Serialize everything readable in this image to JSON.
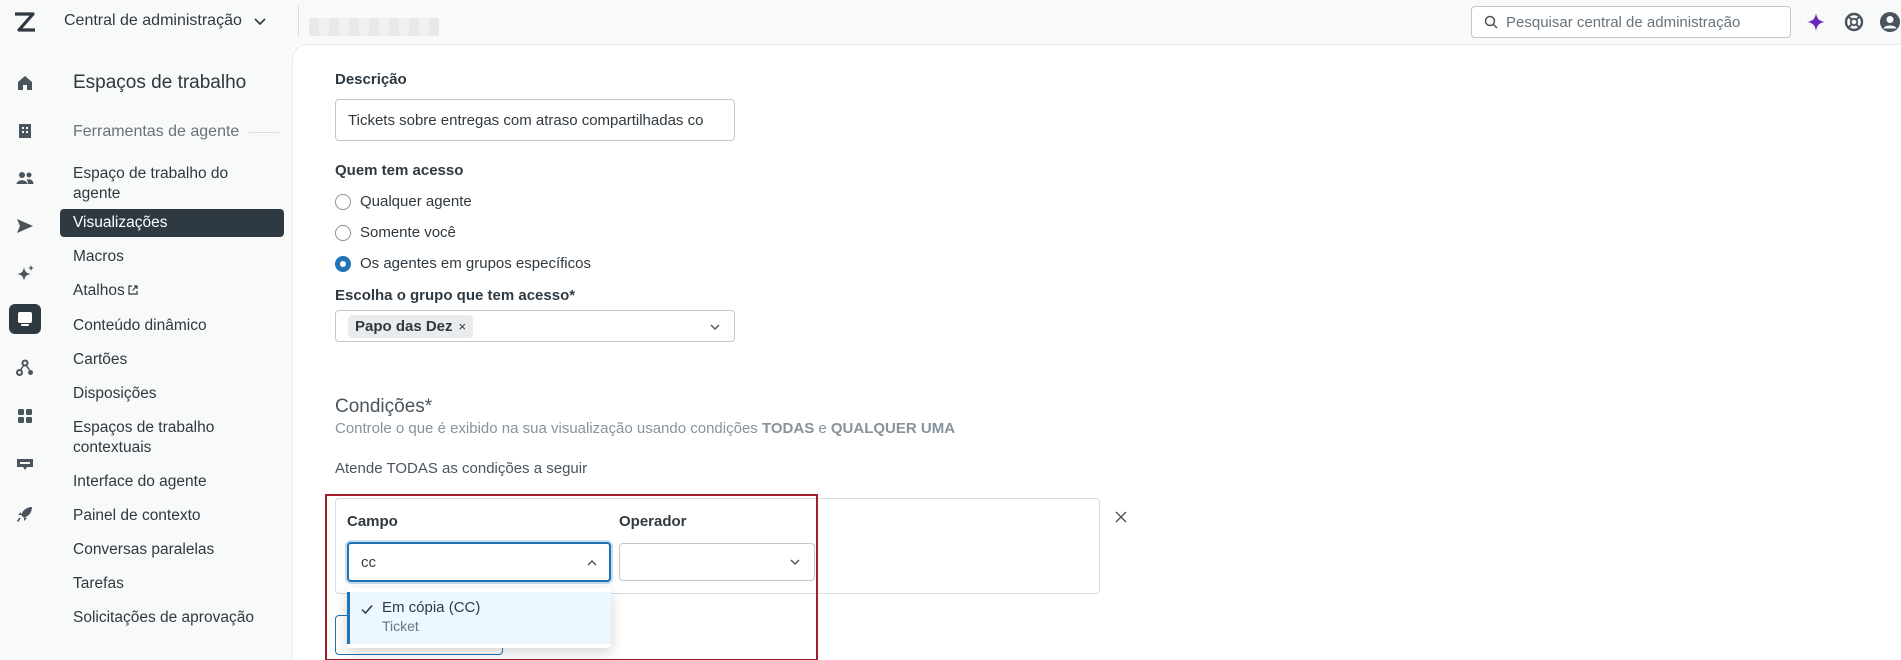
{
  "header": {
    "product_name": "Central de administração",
    "search_placeholder": "Pesquisar central de administração"
  },
  "rail": {
    "icons": [
      "home-icon",
      "building-icon",
      "people-icon",
      "send-icon",
      "sparkle-icon",
      "workspace-icon",
      "objects-icon",
      "apps-icon",
      "channels-icon",
      "rocket-icon"
    ]
  },
  "sidebar": {
    "title": "Espaços de trabalho",
    "section": "Ferramentas de agente",
    "items": [
      {
        "label": "Espaço de trabalho do agente"
      },
      {
        "label": "Visualizações"
      },
      {
        "label": "Macros"
      },
      {
        "label": "Atalhos"
      },
      {
        "label": "Conteúdo dinâmico"
      },
      {
        "label": "Cartões"
      },
      {
        "label": "Disposições"
      },
      {
        "label": "Espaços de trabalho contextuais"
      },
      {
        "label": "Interface do agente"
      },
      {
        "label": "Painel de contexto"
      },
      {
        "label": "Conversas paralelas"
      },
      {
        "label": "Tarefas"
      },
      {
        "label": "Solicitações de aprovação"
      }
    ]
  },
  "form": {
    "description_label": "Descrição",
    "description_value": "Tickets sobre entregas com atraso compartilhadas co",
    "access_label": "Quem tem acesso",
    "access_options": [
      {
        "label": "Qualquer agente",
        "checked": false
      },
      {
        "label": "Somente você",
        "checked": false
      },
      {
        "label": "Os agentes em grupos específicos",
        "checked": true
      }
    ],
    "group_label": "Escolha o grupo que tem acesso*",
    "group_tag": "Papo das Dez",
    "tag_remove": "×"
  },
  "conditions": {
    "heading": "Condições*",
    "desc_prefix": "Controle o que é exibido na sua visualização usando condições",
    "desc_all": "TODAS",
    "desc_and": "e",
    "desc_any": "QUALQUER UMA",
    "all_label": "Atende TODAS as condições a seguir",
    "field_label": "Campo",
    "field_value": "cc",
    "operator_label": "Operador",
    "operator_value": "",
    "option_title": "Em cópia (CC)",
    "option_sub": "Ticket"
  },
  "colors": {
    "accent": "#1f73b7",
    "highlight": "#a31e2a",
    "sidebar_active": "#2f3941",
    "ai_sparkle": "#6a27b8"
  }
}
